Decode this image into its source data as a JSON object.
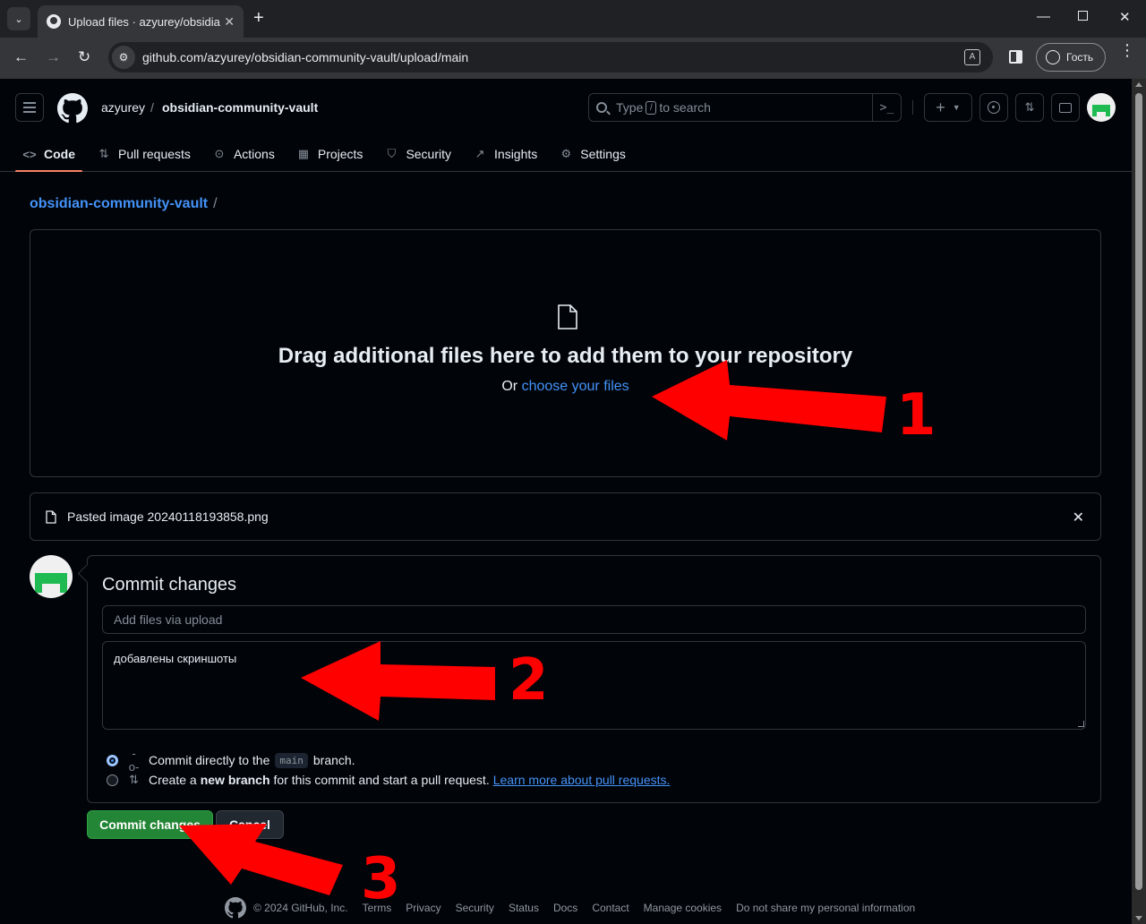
{
  "browser": {
    "tab_title": "Upload files · azyurey/obsidian-",
    "url": "github.com/azyurey/obsidian-community-vault/upload/main",
    "profile_label": "Гость"
  },
  "header": {
    "owner": "azyurey",
    "repo": "obsidian-community-vault",
    "search_prefix": "Type",
    "search_key": "/",
    "search_suffix": "to search"
  },
  "repo_nav": [
    {
      "label": "Code",
      "icon": "code-icon",
      "active": true
    },
    {
      "label": "Pull requests",
      "icon": "git-pull-request-icon"
    },
    {
      "label": "Actions",
      "icon": "play-icon"
    },
    {
      "label": "Projects",
      "icon": "table-icon"
    },
    {
      "label": "Security",
      "icon": "shield-icon"
    },
    {
      "label": "Insights",
      "icon": "graph-icon"
    },
    {
      "label": "Settings",
      "icon": "gear-icon"
    }
  ],
  "breadcrumb": {
    "repo": "obsidian-community-vault",
    "separator": "/"
  },
  "dropzone": {
    "title": "Drag additional files here to add them to your repository",
    "or_text": "Or",
    "choose_link": "choose your files"
  },
  "uploaded_file": {
    "name": "Pasted image 20240118193858.png"
  },
  "commit": {
    "title": "Commit changes",
    "summary_placeholder": "Add files via upload",
    "summary_value": "",
    "description_value": "добавлены скриншоты",
    "option_direct_prefix": "Commit directly to the",
    "branch_name": "main",
    "option_direct_suffix": "branch.",
    "option_new_prefix": "Create a",
    "option_new_bold": "new branch",
    "option_new_middle": "for this commit and start a pull request.",
    "learn_more": "Learn more about pull requests.",
    "commit_button": "Commit changes",
    "cancel_button": "Cancel"
  },
  "footer": {
    "copyright": "© 2024 GitHub, Inc.",
    "links": [
      "Terms",
      "Privacy",
      "Security",
      "Status",
      "Docs",
      "Contact",
      "Manage cookies",
      "Do not share my personal information"
    ]
  },
  "annotations": {
    "labels": [
      "1",
      "2",
      "3"
    ],
    "color": "#ff0000"
  }
}
